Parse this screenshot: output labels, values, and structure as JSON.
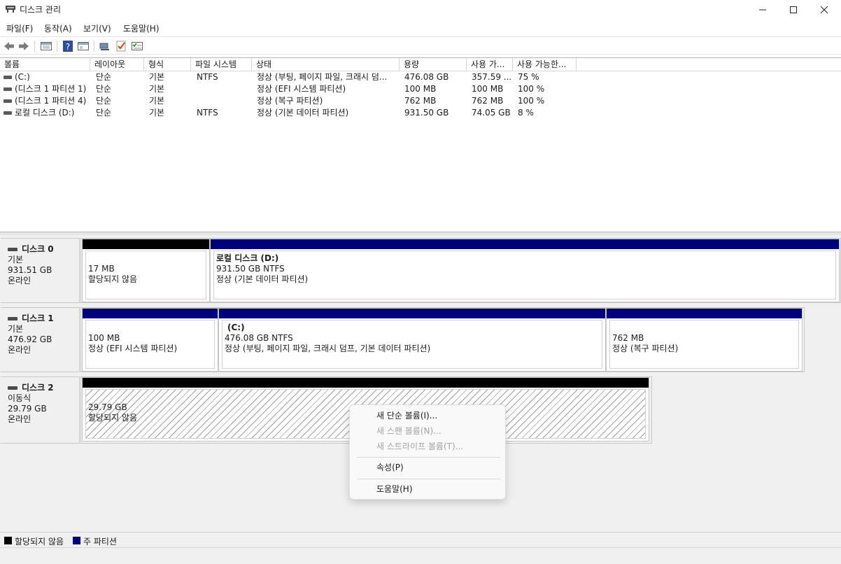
{
  "window": {
    "title": "디스크 관리",
    "minimize_icon": "minimize-icon",
    "maximize_icon": "maximize-icon",
    "close_icon": "close-icon"
  },
  "menu": [
    "파일(F)",
    "동작(A)",
    "보기(V)",
    "도움말(H)"
  ],
  "toolbar": [
    "back-arrow-icon",
    "forward-arrow-icon",
    "list-view-icon",
    "help-icon",
    "properties-icon",
    "connect-icon",
    "check-icon",
    "task-icon"
  ],
  "volume_list": {
    "columns": [
      "볼륨",
      "레이아웃",
      "형식",
      "파일 시스템",
      "상태",
      "용량",
      "사용 가...",
      "사용 가능한..."
    ],
    "rows": [
      {
        "volume": " (C:)",
        "layout": "단순",
        "type": "기본",
        "fs": "NTFS",
        "status": "정상 (부팅, 페이지 파일, 크래시 덤...",
        "capacity": "476.08 GB",
        "free": "357.59 ...",
        "pct": "75 %"
      },
      {
        "volume": "(디스크 1 파티션 1)",
        "layout": "단순",
        "type": "기본",
        "fs": "",
        "status": "정상 (EFI 시스템 파티션)",
        "capacity": "100 MB",
        "free": "100 MB",
        "pct": "100 %"
      },
      {
        "volume": "(디스크 1 파티션 4)",
        "layout": "단순",
        "type": "기본",
        "fs": "",
        "status": "정상 (복구 파티션)",
        "capacity": "762 MB",
        "free": "762 MB",
        "pct": "100 %"
      },
      {
        "volume": "로컬 디스크 (D:)",
        "layout": "단순",
        "type": "기본",
        "fs": "NTFS",
        "status": "정상 (기본 데이터 파티션)",
        "capacity": "931.50 GB",
        "free": "74.05 GB",
        "pct": "8 %"
      }
    ]
  },
  "disks": [
    {
      "name": "디스크 0",
      "kind": "기본",
      "size": "931.51 GB",
      "state": "온라인",
      "partitions": [
        {
          "title": "",
          "line1": "17 MB",
          "line2": "할당되지 않음",
          "bar": "#000000"
        },
        {
          "title": "로컬 디스크  (D:)",
          "line1": "931.50 GB NTFS",
          "line2": "정상 (기본 데이터 파티션)",
          "bar": "#00007d"
        }
      ]
    },
    {
      "name": "디스크 1",
      "kind": "기본",
      "size": "476.92 GB",
      "state": "온라인",
      "partitions": [
        {
          "title": "",
          "line1": "100 MB",
          "line2": "정상 (EFI 시스템 파티션)",
          "bar": "#00007d"
        },
        {
          "title": " (C:)",
          "line1": "476.08 GB NTFS",
          "line2": "정상 (부팅, 페이지 파일, 크래시 덤프, 기본 데이터 파티션)",
          "bar": "#00007d"
        },
        {
          "title": "",
          "line1": "762 MB",
          "line2": "정상 (복구 파티션)",
          "bar": "#00007d"
        }
      ]
    },
    {
      "name": "디스크 2",
      "kind": "이동식",
      "size": "29.79 GB",
      "state": "온라인",
      "partitions": [
        {
          "title": "",
          "line1": "29.79 GB",
          "line2": "할당되지 않음",
          "bar": "#000000"
        }
      ]
    }
  ],
  "legend": [
    {
      "label": "할당되지 않음",
      "color": "#000000"
    },
    {
      "label": "주 파티션",
      "color": "#00007d"
    }
  ],
  "context_menu": {
    "items": [
      {
        "label": "새 단순 볼륨(I)...",
        "enabled": true
      },
      {
        "label": "새 스팬 볼륨(N)...",
        "enabled": false
      },
      {
        "label": "새 스트라이프 볼륨(T)...",
        "enabled": false
      },
      {
        "label": "속성(P)",
        "enabled": true
      },
      {
        "label": "도움말(H)",
        "enabled": true
      }
    ]
  }
}
